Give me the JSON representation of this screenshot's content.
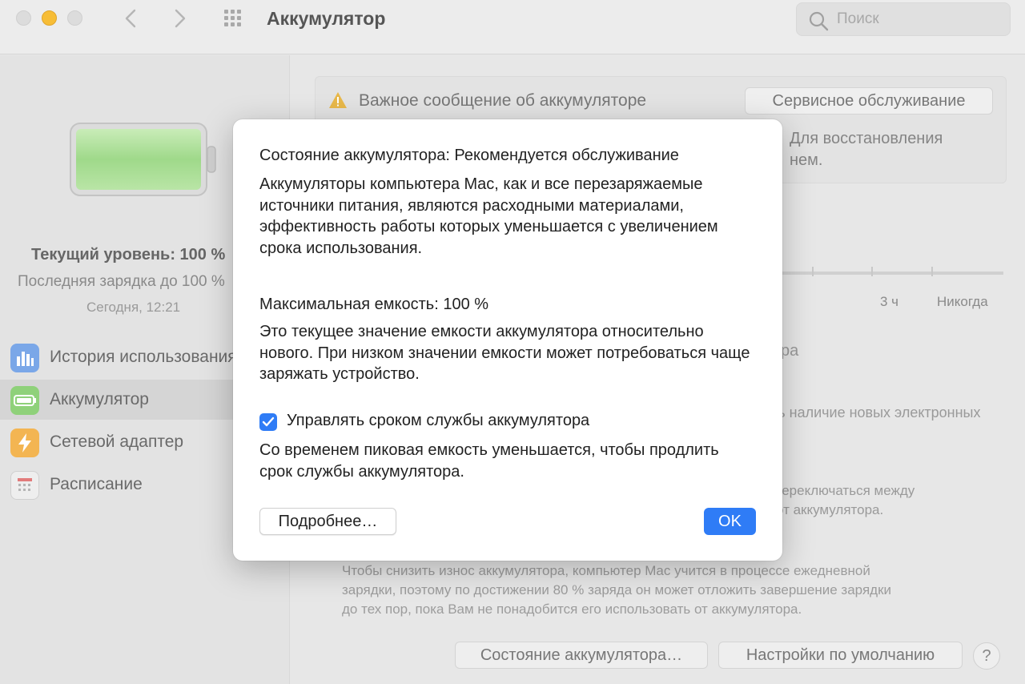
{
  "window": {
    "title": "Аккумулятор",
    "search_placeholder": "Поиск"
  },
  "sidebar": {
    "current_level": "Текущий уровень: 100 %",
    "last_charge": "Последняя зарядка до 100 %",
    "last_charge_time": "Сегодня, 12:21",
    "items": [
      {
        "label": "История использования"
      },
      {
        "label": "Аккумулятор"
      },
      {
        "label": "Сетевой адаптер"
      },
      {
        "label": "Расписание"
      }
    ],
    "selected_index": 1
  },
  "main": {
    "important_message": "Важное сообщение об аккумуляторе",
    "service_button": "Сервисное обслуживание",
    "message_text_line1": "Для восстановления",
    "message_text_line2": "нем.",
    "slider_labels": [
      "3 ч",
      "Никогда"
    ],
    "partial_text_1": "ра",
    "partial_text_2": "ть наличие новых электронных",
    "partial_text_3": "переключаться между",
    "partial_text_4": "от аккумулятора.",
    "optimized_text": [
      "Чтобы снизить износ аккумулятора, компьютер Mac учится в процессе ежедневной",
      "зарядки, поэтому по достижении 80 % заряда он может отложить завершение зарядки",
      "до тех пор, пока Вам не понадобится его использовать от аккумулятора."
    ],
    "battery_health_button": "Состояние аккумулятора…",
    "defaults_button": "Настройки по умолчанию",
    "help_button": "?"
  },
  "dialog": {
    "heading": "Состояние аккумулятора: Рекомендуется обслуживание",
    "body1": "Аккумуляторы компьютера Mac, как и все перезаряжаемые источники питания, являются расходными материалами, эффективность работы которых уменьшается с увеличением срока использования.",
    "max_capacity": "Максимальная емкость: 100 %",
    "body2": "Это текущее значение емкости аккумулятора относительно нового. При низком значении емкости может потребоваться чаще заряжать устройство.",
    "checkbox_label": "Управлять сроком службы аккумулятора",
    "checkbox_checked": true,
    "body3": "Со временем пиковая емкость уменьшается, чтобы продлить срок службы аккумулятора.",
    "more_button": "Подробнее…",
    "ok_button": "OK"
  },
  "colors": {
    "accent": "#2f7cf6",
    "minimize_light": "#f7bd36",
    "battery_fill": "#9fd98a"
  },
  "battery_level_fraction": 1.0
}
